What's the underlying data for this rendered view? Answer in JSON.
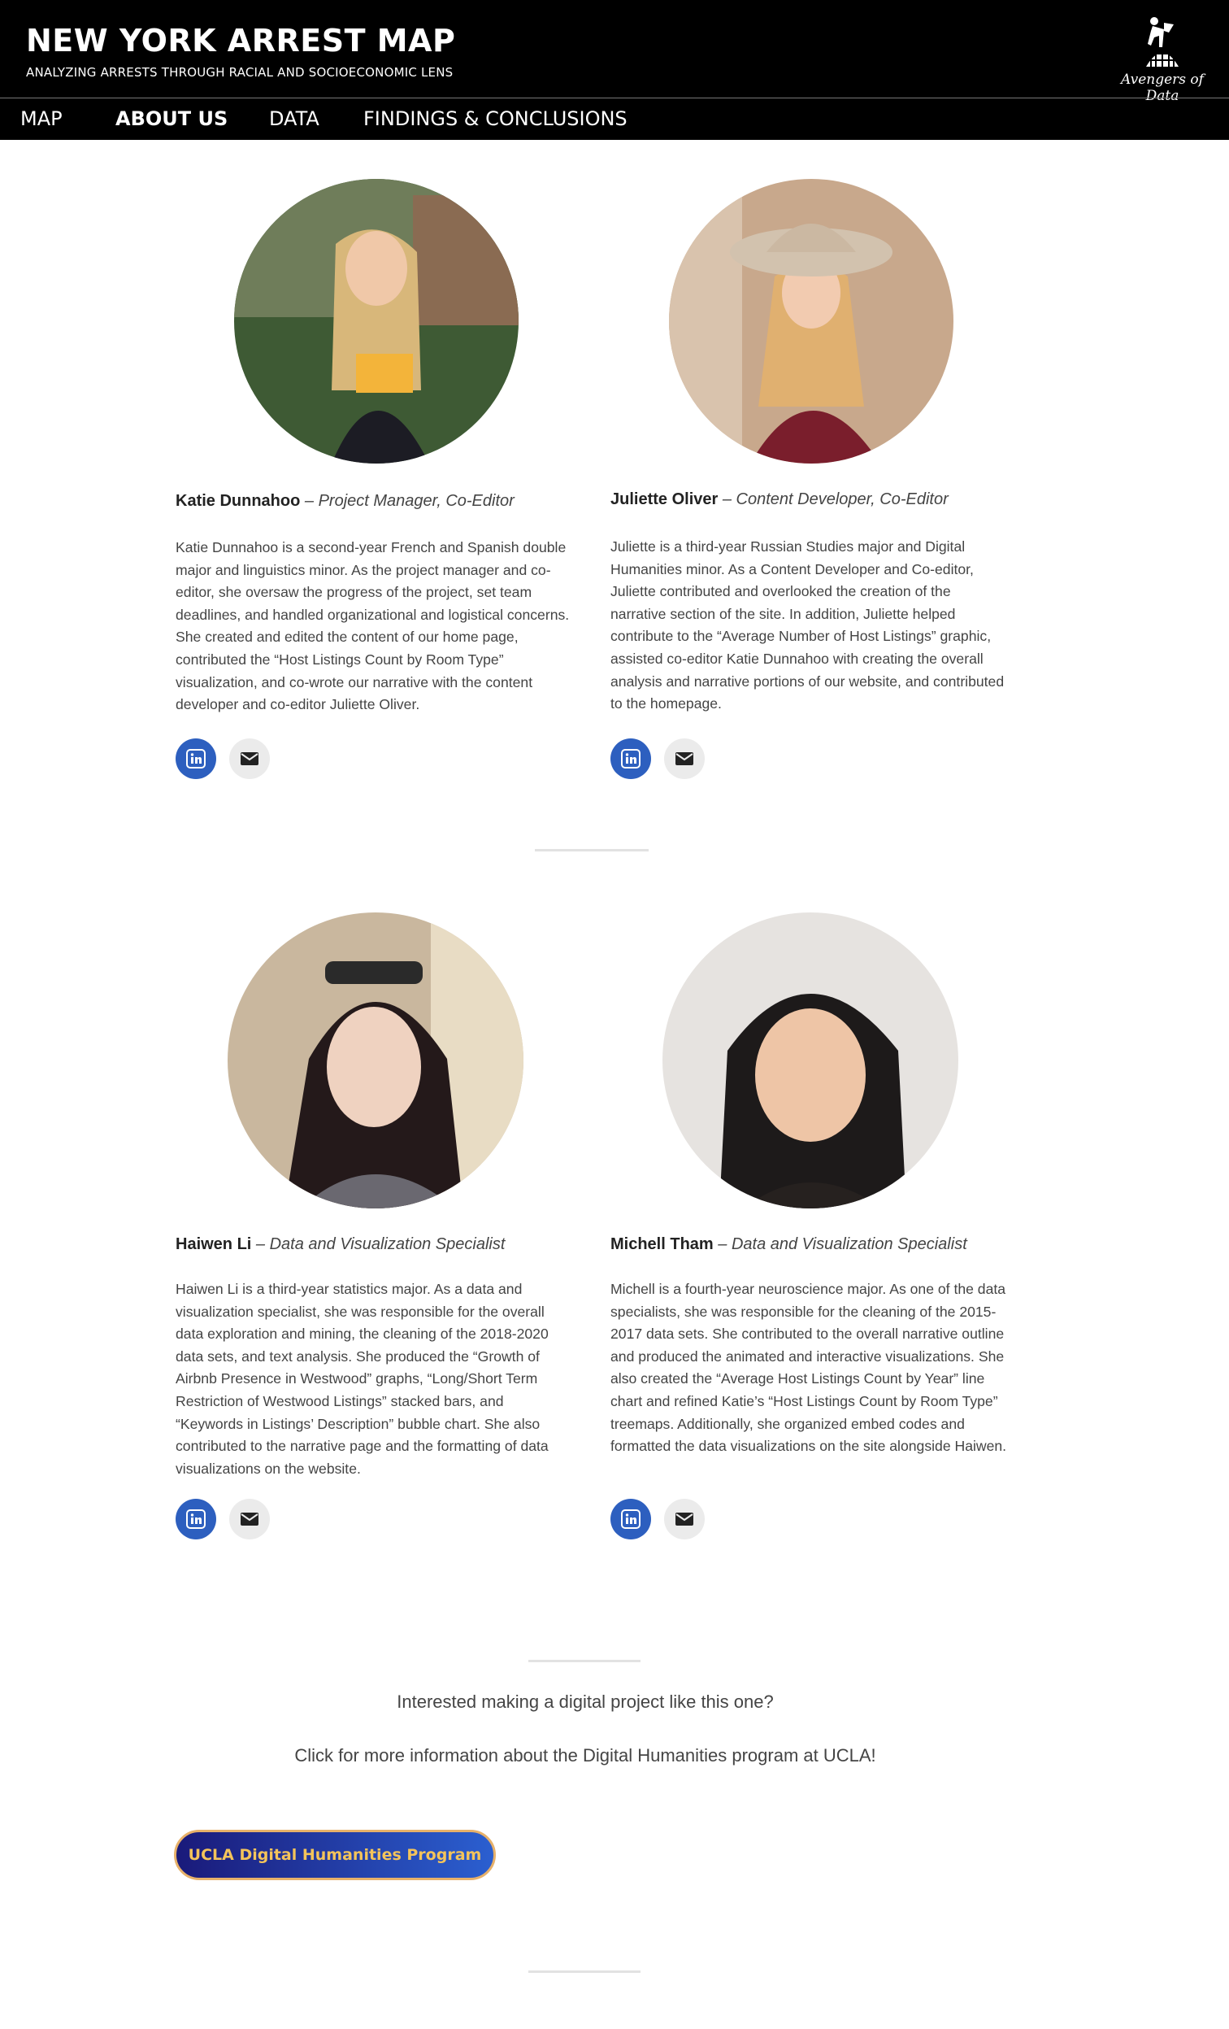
{
  "header": {
    "title": "NEW YORK ARREST MAP",
    "tagline": "ANALYZING ARRESTS THROUGH RACIAL AND SOCIOECONOMIC LENS",
    "logo_text": "Avengers of Data",
    "logo_icon": "figure-on-globe-icon"
  },
  "nav": {
    "items": [
      {
        "label": "MAP"
      },
      {
        "label": "ABOUT US",
        "active": true
      },
      {
        "label": "DATA"
      },
      {
        "label": "FINDINGS & CONCLUSIONS"
      }
    ]
  },
  "team": [
    {
      "name": "Katie Dunnahoo",
      "role": " – Project Manager, Co-Editor",
      "bio": "Katie Dunnahoo is a second-year French and Spanish double major and linguistics minor. As the project manager and co-editor, she oversaw the progress of the project, set team deadlines, and handled organizational and logistical concerns. She created and edited the content of our home page, contributed the “Host Listings Count by Room Type” visualization, and co-wrote our narrative with the content developer and co-editor Juliette Oliver."
    },
    {
      "name": "Juliette Oliver",
      "role": " – Content Developer, Co-Editor",
      "bio": "Juliette is a third-year Russian Studies major and Digital Humanities minor. As a Content Developer and Co-editor, Juliette contributed and overlooked the creation of the narrative section of the site. In addition, Juliette helped contribute to the “Average Number of Host Listings” graphic, assisted co-editor Katie Dunnahoo with creating the overall analysis and narrative portions of our website, and contributed to the homepage."
    },
    {
      "name": "Haiwen Li",
      "role": " – Data and Visualization Specialist",
      "bio": "Haiwen Li is a third-year statistics major. As a data and visualization specialist, she was responsible for the overall data exploration and mining, the cleaning of the 2018-2020 data sets, and text analysis. She produced the “Growth of Airbnb Presence in Westwood” graphs, “Long/Short Term Restriction of Westwood Listings” stacked bars, and “Keywords in Listings’ Description” bubble chart. She also contributed to the narrative page and the formatting of data visualizations on the website."
    },
    {
      "name": "Michell Tham",
      "role": " – Data and Visualization Specialist",
      "bio": "Michell is a fourth-year neuroscience major. As one of the data specialists, she was responsible for the cleaning of the 2015-2017 data sets. She contributed to the overall narrative outline and produced the animated and interactive visualizations. She also created the “Average Host Listings Count by Year” line chart and refined Katie’s “Host Listings Count by Room Type” treemaps. Additionally, she organized embed codes and formatted the data visualizations on the site alongside Haiwen."
    }
  ],
  "footer": {
    "prompt": "Interested making a digital project like this one?",
    "info": "Click for more information about the Digital Humanities program at UCLA!",
    "button_label": "UCLA Digital Humanities Program"
  },
  "colors": {
    "header_bg": "#000000",
    "linkedin": "#2d5fbf",
    "button_gradient_start": "#1a1a7a",
    "button_gradient_end": "#2b5fd0",
    "button_text": "#f4c45a"
  }
}
